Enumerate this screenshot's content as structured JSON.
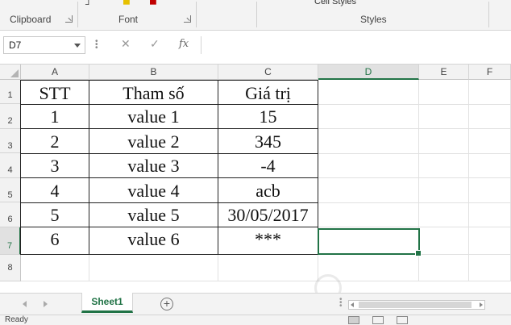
{
  "ribbon": {
    "groups": [
      {
        "label": "Clipboard"
      },
      {
        "label": "Font"
      },
      {
        "label": "Styles"
      }
    ],
    "cell_styles_label": "Cell Styles"
  },
  "formula_bar": {
    "name_box": "D7",
    "cancel_icon": "close-icon",
    "enter_icon": "check-icon",
    "function_label": "fx",
    "formula": ""
  },
  "sheet": {
    "columns": [
      "A",
      "B",
      "C",
      "D",
      "E",
      "F"
    ],
    "rows": [
      "1",
      "2",
      "3",
      "4",
      "5",
      "6",
      "7",
      "8"
    ],
    "selected_column": "D",
    "selected_row": "7",
    "table": {
      "headers": [
        "STT",
        "Tham số",
        "Giá trị"
      ],
      "rows": [
        [
          "1",
          "value 1",
          "15"
        ],
        [
          "2",
          "value 2",
          "345"
        ],
        [
          "3",
          "value 3",
          "-4"
        ],
        [
          "4",
          "value 4",
          "acb"
        ],
        [
          "5",
          "value 5",
          "30/05/2017"
        ],
        [
          "6",
          "value 6",
          "***"
        ]
      ]
    }
  },
  "tabs": {
    "active_sheet": "Sheet1",
    "add_icon": "plus-icon"
  },
  "status": {
    "text": "Ready"
  },
  "colors": {
    "accent": "#217346",
    "header_bg": "#f2f2f2",
    "ribbon_bg": "#f3f3f3"
  }
}
